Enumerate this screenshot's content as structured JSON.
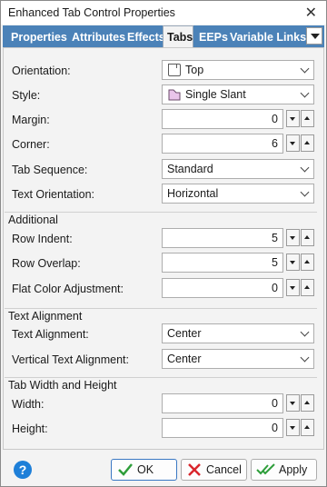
{
  "window": {
    "title": "Enhanced Tab Control Properties"
  },
  "tabs": [
    {
      "label": "Properties"
    },
    {
      "label": "Attributes"
    },
    {
      "label": "Effects"
    },
    {
      "label": "Tabs"
    },
    {
      "label": "EEPs"
    },
    {
      "label": "Variable Links"
    }
  ],
  "active_tab": "Tabs",
  "fields": {
    "orientation": {
      "label": "Orientation:",
      "value": "Top",
      "icon": "tab-top-icon"
    },
    "style": {
      "label": "Style:",
      "value": "Single Slant",
      "icon": "slant-tab-icon"
    },
    "margin": {
      "label": "Margin:",
      "value": "0"
    },
    "corner": {
      "label": "Corner:",
      "value": "6"
    },
    "tab_sequence": {
      "label": "Tab Sequence:",
      "value": "Standard"
    },
    "text_orientation": {
      "label": "Text Orientation:",
      "value": "Horizontal"
    }
  },
  "additional": {
    "title": "Additional",
    "row_indent": {
      "label": "Row Indent:",
      "value": "5"
    },
    "row_overlap": {
      "label": "Row Overlap:",
      "value": "5"
    },
    "flat_color_adjustment": {
      "label": "Flat Color Adjustment:",
      "value": "0"
    }
  },
  "text_alignment": {
    "title": "Text Alignment",
    "text_alignment": {
      "label": "Text Alignment:",
      "value": "Center"
    },
    "vertical_text_alignment": {
      "label": "Vertical Text Alignment:",
      "value": "Center"
    }
  },
  "tab_size": {
    "title": "Tab Width and Height",
    "width": {
      "label": "Width:",
      "value": "0"
    },
    "height": {
      "label": "Height:",
      "value": "0"
    }
  },
  "buttons": {
    "ok": "OK",
    "cancel": "Cancel",
    "apply": "Apply",
    "help": "?"
  },
  "colors": {
    "tab_strip": "#4b82b8",
    "help": "#1e7fd8",
    "ok_check": "#2e9e3a",
    "cancel_x": "#d9262c"
  }
}
